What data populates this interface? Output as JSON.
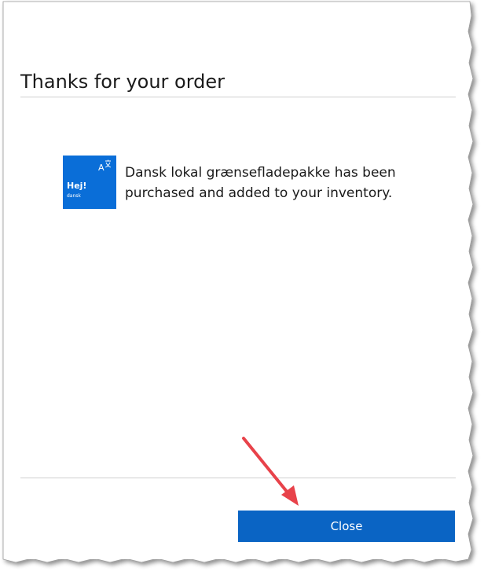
{
  "dialog": {
    "title": "Thanks for your order",
    "message": "Dansk lokal grænsefladepakke has been purchased and added to your inventory.",
    "product_tile": {
      "greeting": "Hej!",
      "language": "dansk",
      "icon": "language-icon",
      "background_color": "#0a6ed8"
    },
    "close_label": "Close",
    "accent_color": "#0a64c4"
  },
  "annotation": {
    "icon": "red-arrow",
    "color": "#e8424a"
  }
}
